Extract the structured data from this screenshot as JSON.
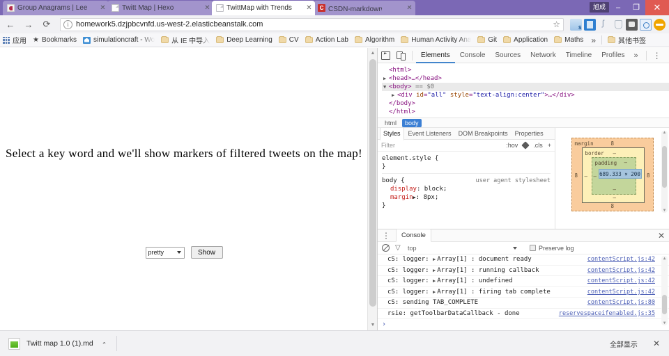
{
  "window": {
    "user_badge": "旭成",
    "minimize_label": "–",
    "maximize_label": "❐",
    "close_label": "✕"
  },
  "tabs": [
    {
      "title": "Group Anagrams | Lee",
      "favicon": "leetcode-icon",
      "close_label": "✕",
      "active": false
    },
    {
      "title": "Twitt Map | Hexo",
      "favicon": "document-icon",
      "close_label": "✕",
      "active": false
    },
    {
      "title": "TwittMap with Trends",
      "favicon": "document-icon",
      "close_label": "✕",
      "active": true
    },
    {
      "title": "CSDN-markdown编辑",
      "favicon": "csdn-icon",
      "close_label": "✕",
      "active": false
    }
  ],
  "nav": {
    "back_label": "←",
    "forward_label": "→",
    "reload_label": "⟳",
    "info_label": "i",
    "url": "homework5.dzjpbcvnfd.us-west-2.elasticbeanstalk.com",
    "star_label": "☆"
  },
  "bookmarks": {
    "apps_label": "应用",
    "star_label": "★",
    "bookmarks_label": "Bookmarks",
    "home_label": "simulationcraft - Wo",
    "items": [
      "从 IE 中导入",
      "Deep Learning",
      "CV",
      "Action Lab",
      "Algorithm",
      "Human Activity Ana",
      "Git",
      "Application",
      "Maths"
    ],
    "overflow_label": "»",
    "other_label": "其他书签"
  },
  "page": {
    "heading": "Select a key word and we'll show markers of filtered tweets on the map!",
    "select_value": "pretty",
    "show_button": "Show"
  },
  "devtools": {
    "tabs": [
      {
        "label": "Elements",
        "active": true
      },
      {
        "label": "Console",
        "active": false
      },
      {
        "label": "Sources",
        "active": false
      },
      {
        "label": "Network",
        "active": false
      },
      {
        "label": "Timeline",
        "active": false
      },
      {
        "label": "Profiles",
        "active": false
      }
    ],
    "more_label": "»",
    "kebab_label": "⋮",
    "close_label": "✕",
    "dom": {
      "line1": "<html>",
      "line2": "<head>…</head>",
      "line3_tag": "<body>",
      "line3_sel": "== $0",
      "line4_open": "<div ",
      "line4_attr": "id",
      "line4_val": "\"all\"",
      "line4_attr2": " style",
      "line4_val2": "\"text-align:center\"",
      "line4_close": ">…</div>",
      "line5": "</body>",
      "line6": "</html>"
    },
    "breadcrumbs": [
      {
        "label": "html",
        "active": false
      },
      {
        "label": "body",
        "active": true
      }
    ],
    "style_tabs": [
      {
        "label": "Styles",
        "active": true
      },
      {
        "label": "Event Listeners",
        "active": false
      },
      {
        "label": "DOM Breakpoints",
        "active": false
      },
      {
        "label": "Properties",
        "active": false
      }
    ],
    "filter_placeholder": "Filter",
    "hov_label": ":hov",
    "cls_label": ".cls",
    "plus_label": "+",
    "rules": {
      "element_style": "element.style {",
      "element_style_close": "}",
      "body_selector": "body {",
      "body_origin": "user agent stylesheet",
      "prop1_name": "display",
      "prop1_value": ": block;",
      "prop2_name": "margin",
      "prop2_value": ": 8px;",
      "prop2_arrow": "▶",
      "body_close": "}"
    },
    "box_model": {
      "margin_label": "margin",
      "border_label": "border",
      "padding_label": "padding",
      "content_size": "689.333 × 200",
      "margin_top": "8",
      "margin_bottom": "8",
      "margin_left": "8",
      "margin_right": "8",
      "border_top": "–",
      "border_bottom": "–",
      "border_left": "–",
      "border_right": "–",
      "padding_top": "–",
      "padding_bottom": "–",
      "padding_left": "–",
      "padding_right": "–"
    }
  },
  "console": {
    "drawer_tab": "Console",
    "kebab_label": "⋮",
    "close_label": "✕",
    "clear_label": "clear-console",
    "filter_label": "filter",
    "context": "top",
    "preserve_log": "Preserve log",
    "prompt": "›",
    "logs": [
      {
        "prefix": "cS: logger:",
        "arrow": "▶",
        "object": "Array[1]",
        "message": " : document ready",
        "source": "contentScript.js:42"
      },
      {
        "prefix": "cS: logger:",
        "arrow": "▶",
        "object": "Array[1]",
        "message": " : running callback",
        "source": "contentScript.js:42"
      },
      {
        "prefix": "cS: logger:",
        "arrow": "▶",
        "object": "Array[1]",
        "message": " : undefined",
        "source": "contentScript.js:42"
      },
      {
        "prefix": "cS: logger:",
        "arrow": "▶",
        "object": "Array[1]",
        "message": " : firing tab complete",
        "source": "contentScript.js:42"
      },
      {
        "prefix": "cS: sending TAB_COMPLETE",
        "arrow": "",
        "object": "",
        "message": "",
        "source": "contentScript.js:80"
      },
      {
        "prefix": "rsie: getToolbarDataCallback - done",
        "arrow": "",
        "object": "",
        "message": "",
        "source": "reservespaceifenabled.js:35"
      }
    ]
  },
  "download_shelf": {
    "file_name": "Twitt map 1.0 (1).md",
    "caret_label": "⌄",
    "show_all_label": "全部显示",
    "close_label": "✕"
  },
  "colors": {
    "frame": "#7b68b5",
    "accent": "#4285cc",
    "close_red": "#e05a52",
    "breadcrumb_active": "#3b7fd4"
  }
}
